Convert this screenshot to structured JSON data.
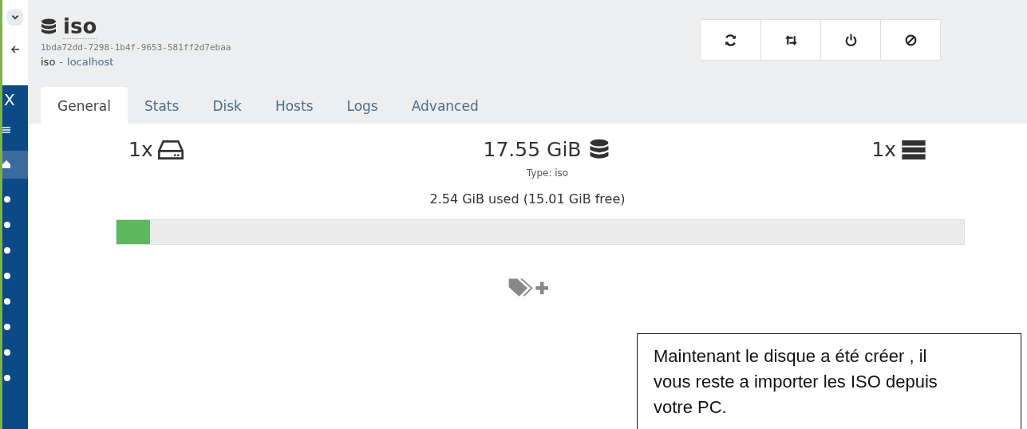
{
  "browser": {
    "sidebar_letter": "X"
  },
  "header": {
    "title": "iso",
    "uuid": "1bda72dd-7298-1b4f-9653-581ff2d7ebaa",
    "subtitle": "iso",
    "separator": "-",
    "host": "localhost"
  },
  "tabs": [
    {
      "label": "General",
      "selected": true
    },
    {
      "label": "Stats",
      "selected": false
    },
    {
      "label": "Disk",
      "selected": false
    },
    {
      "label": "Hosts",
      "selected": false
    },
    {
      "label": "Logs",
      "selected": false
    },
    {
      "label": "Advanced",
      "selected": false
    }
  ],
  "summary": {
    "disks": "1x",
    "size": "17.55 GiB",
    "type": "Type: iso",
    "hosts": "1x"
  },
  "usage": {
    "text": "2.54 GiB used (15.01 GiB free)",
    "level": 0.04
  },
  "note": "Maintenant le disque a été créer , il vous reste a importer les ISO depuis votre PC."
}
